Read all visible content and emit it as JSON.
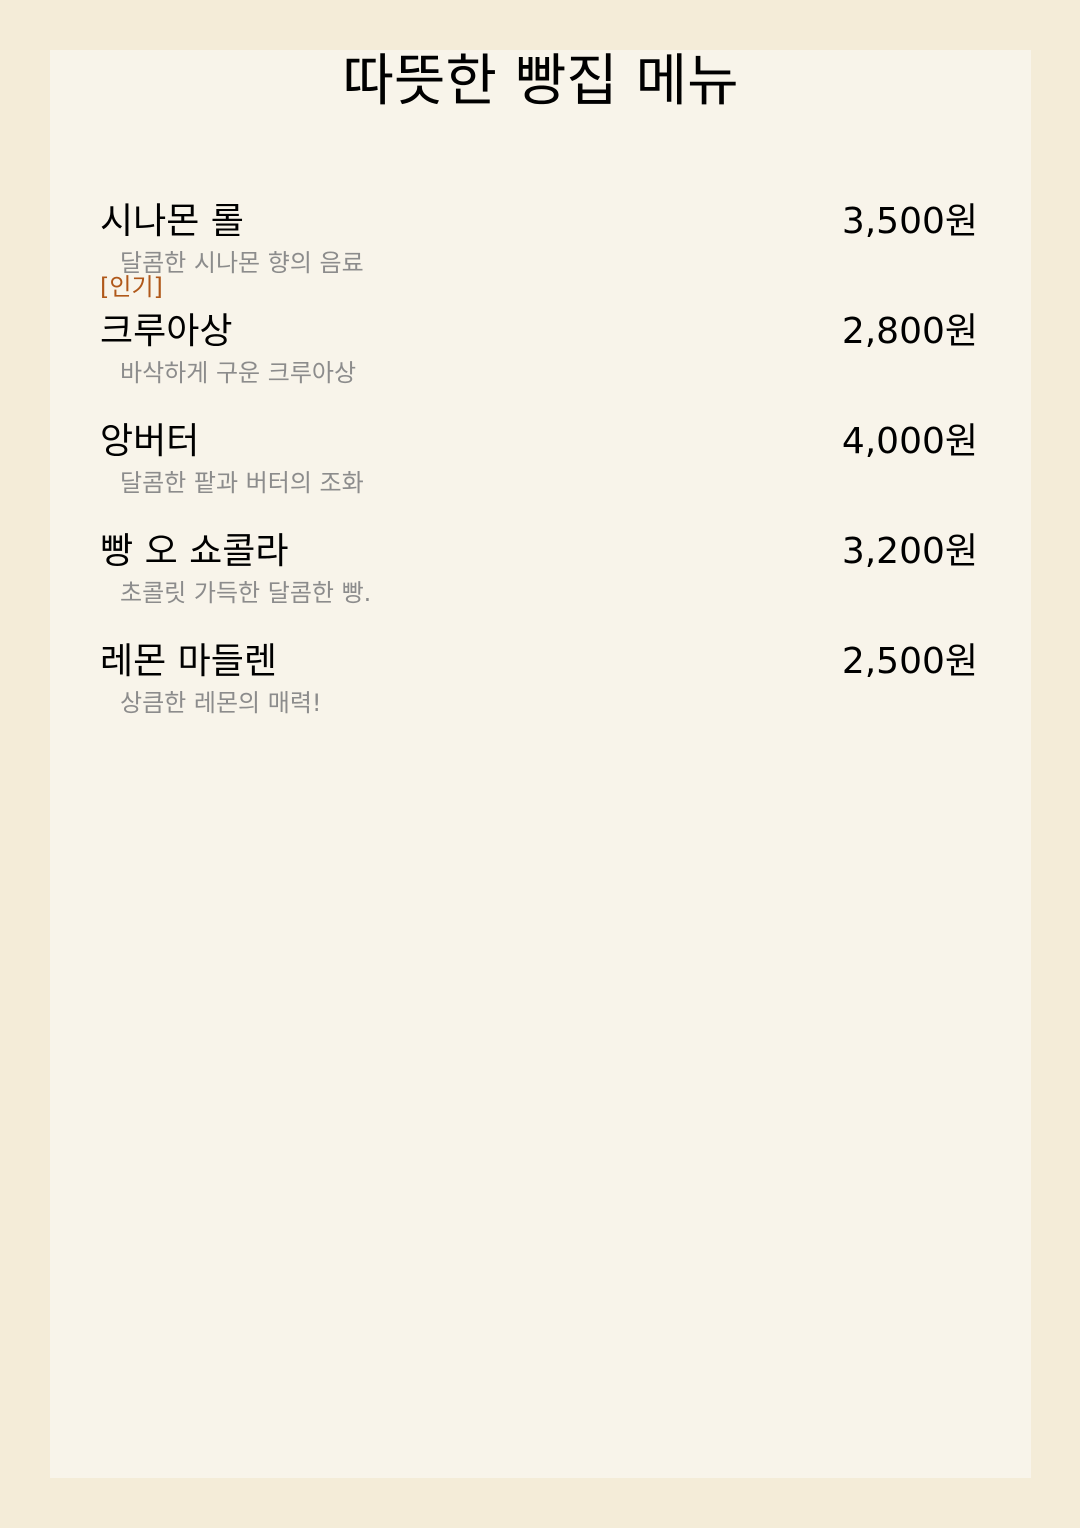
{
  "title": "따뜻한 빵집 메뉴",
  "items": [
    {
      "name": "시나몬 롤",
      "price": "3,500원",
      "description": "달콤한 시나몬 향의 음료",
      "tag": "[인기]"
    },
    {
      "name": "크루아상",
      "price": "2,800원",
      "description": "바삭하게 구운 크루아상"
    },
    {
      "name": "앙버터",
      "price": "4,000원",
      "description": "달콤한 팥과 버터의 조화"
    },
    {
      "name": "빵 오 쇼콜라",
      "price": "3,200원",
      "description": "초콜릿 가득한 달콤한 빵."
    },
    {
      "name": "레몬 마들렌",
      "price": "2,500원",
      "description": "상큼한 레몬의 매력!"
    }
  ],
  "colors": {
    "page_background": "#f4ecd8",
    "card_background": "#f8f4ea",
    "description_text": "#8c8c8c",
    "tag_text": "#b0581a"
  }
}
